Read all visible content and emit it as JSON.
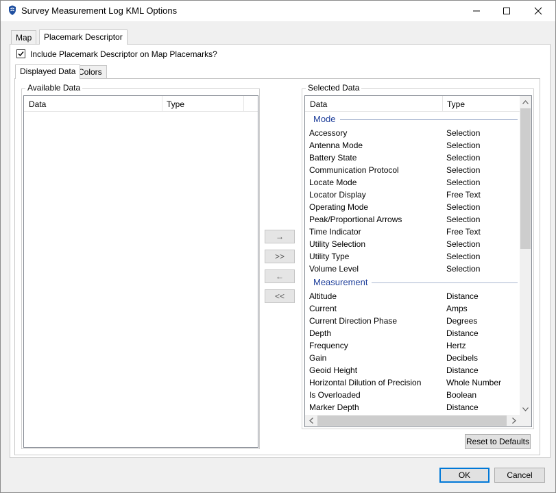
{
  "window": {
    "title": "Survey Measurement Log KML Options"
  },
  "tabs": [
    {
      "label": "Map",
      "active": false
    },
    {
      "label": "Placemark Descriptor",
      "active": true
    }
  ],
  "include_checkbox": {
    "label": "Include Placemark Descriptor on Map Placemarks?",
    "checked": true
  },
  "subtabs": [
    {
      "label": "Displayed Data",
      "active": true
    },
    {
      "label": "Colors",
      "active": false
    }
  ],
  "available": {
    "title": "Available Data",
    "col_data": "Data",
    "col_type": "Type"
  },
  "selected": {
    "title": "Selected Data",
    "col_data": "Data",
    "col_type": "Type",
    "groups": [
      {
        "name": "Mode",
        "rows": [
          {
            "data": "Accessory",
            "type": "Selection"
          },
          {
            "data": "Antenna Mode",
            "type": "Selection"
          },
          {
            "data": "Battery State",
            "type": "Selection"
          },
          {
            "data": "Communication Protocol",
            "type": "Selection"
          },
          {
            "data": "Locate Mode",
            "type": "Selection"
          },
          {
            "data": "Locator Display",
            "type": "Free Text"
          },
          {
            "data": "Operating Mode",
            "type": "Selection"
          },
          {
            "data": "Peak/Proportional Arrows",
            "type": "Selection"
          },
          {
            "data": "Time Indicator",
            "type": "Free Text"
          },
          {
            "data": "Utility Selection",
            "type": "Selection"
          },
          {
            "data": "Utility Type",
            "type": "Selection"
          },
          {
            "data": "Volume Level",
            "type": "Selection"
          }
        ]
      },
      {
        "name": "Measurement",
        "rows": [
          {
            "data": "Altitude",
            "type": "Distance"
          },
          {
            "data": "Current",
            "type": "Amps"
          },
          {
            "data": "Current Direction Phase",
            "type": "Degrees"
          },
          {
            "data": "Depth",
            "type": "Distance"
          },
          {
            "data": "Frequency",
            "type": "Hertz"
          },
          {
            "data": "Gain",
            "type": "Decibels"
          },
          {
            "data": "Geoid Height",
            "type": "Distance"
          },
          {
            "data": "Horizontal Dilution of Precision",
            "type": "Whole Number"
          },
          {
            "data": "Is Overloaded",
            "type": "Boolean"
          },
          {
            "data": "Marker Depth",
            "type": "Distance"
          }
        ]
      }
    ]
  },
  "move_buttons": {
    "add": "→",
    "add_all": ">>",
    "remove": "←",
    "remove_all": "<<"
  },
  "reset_label": "Reset to Defaults",
  "ok_label": "OK",
  "cancel_label": "Cancel"
}
